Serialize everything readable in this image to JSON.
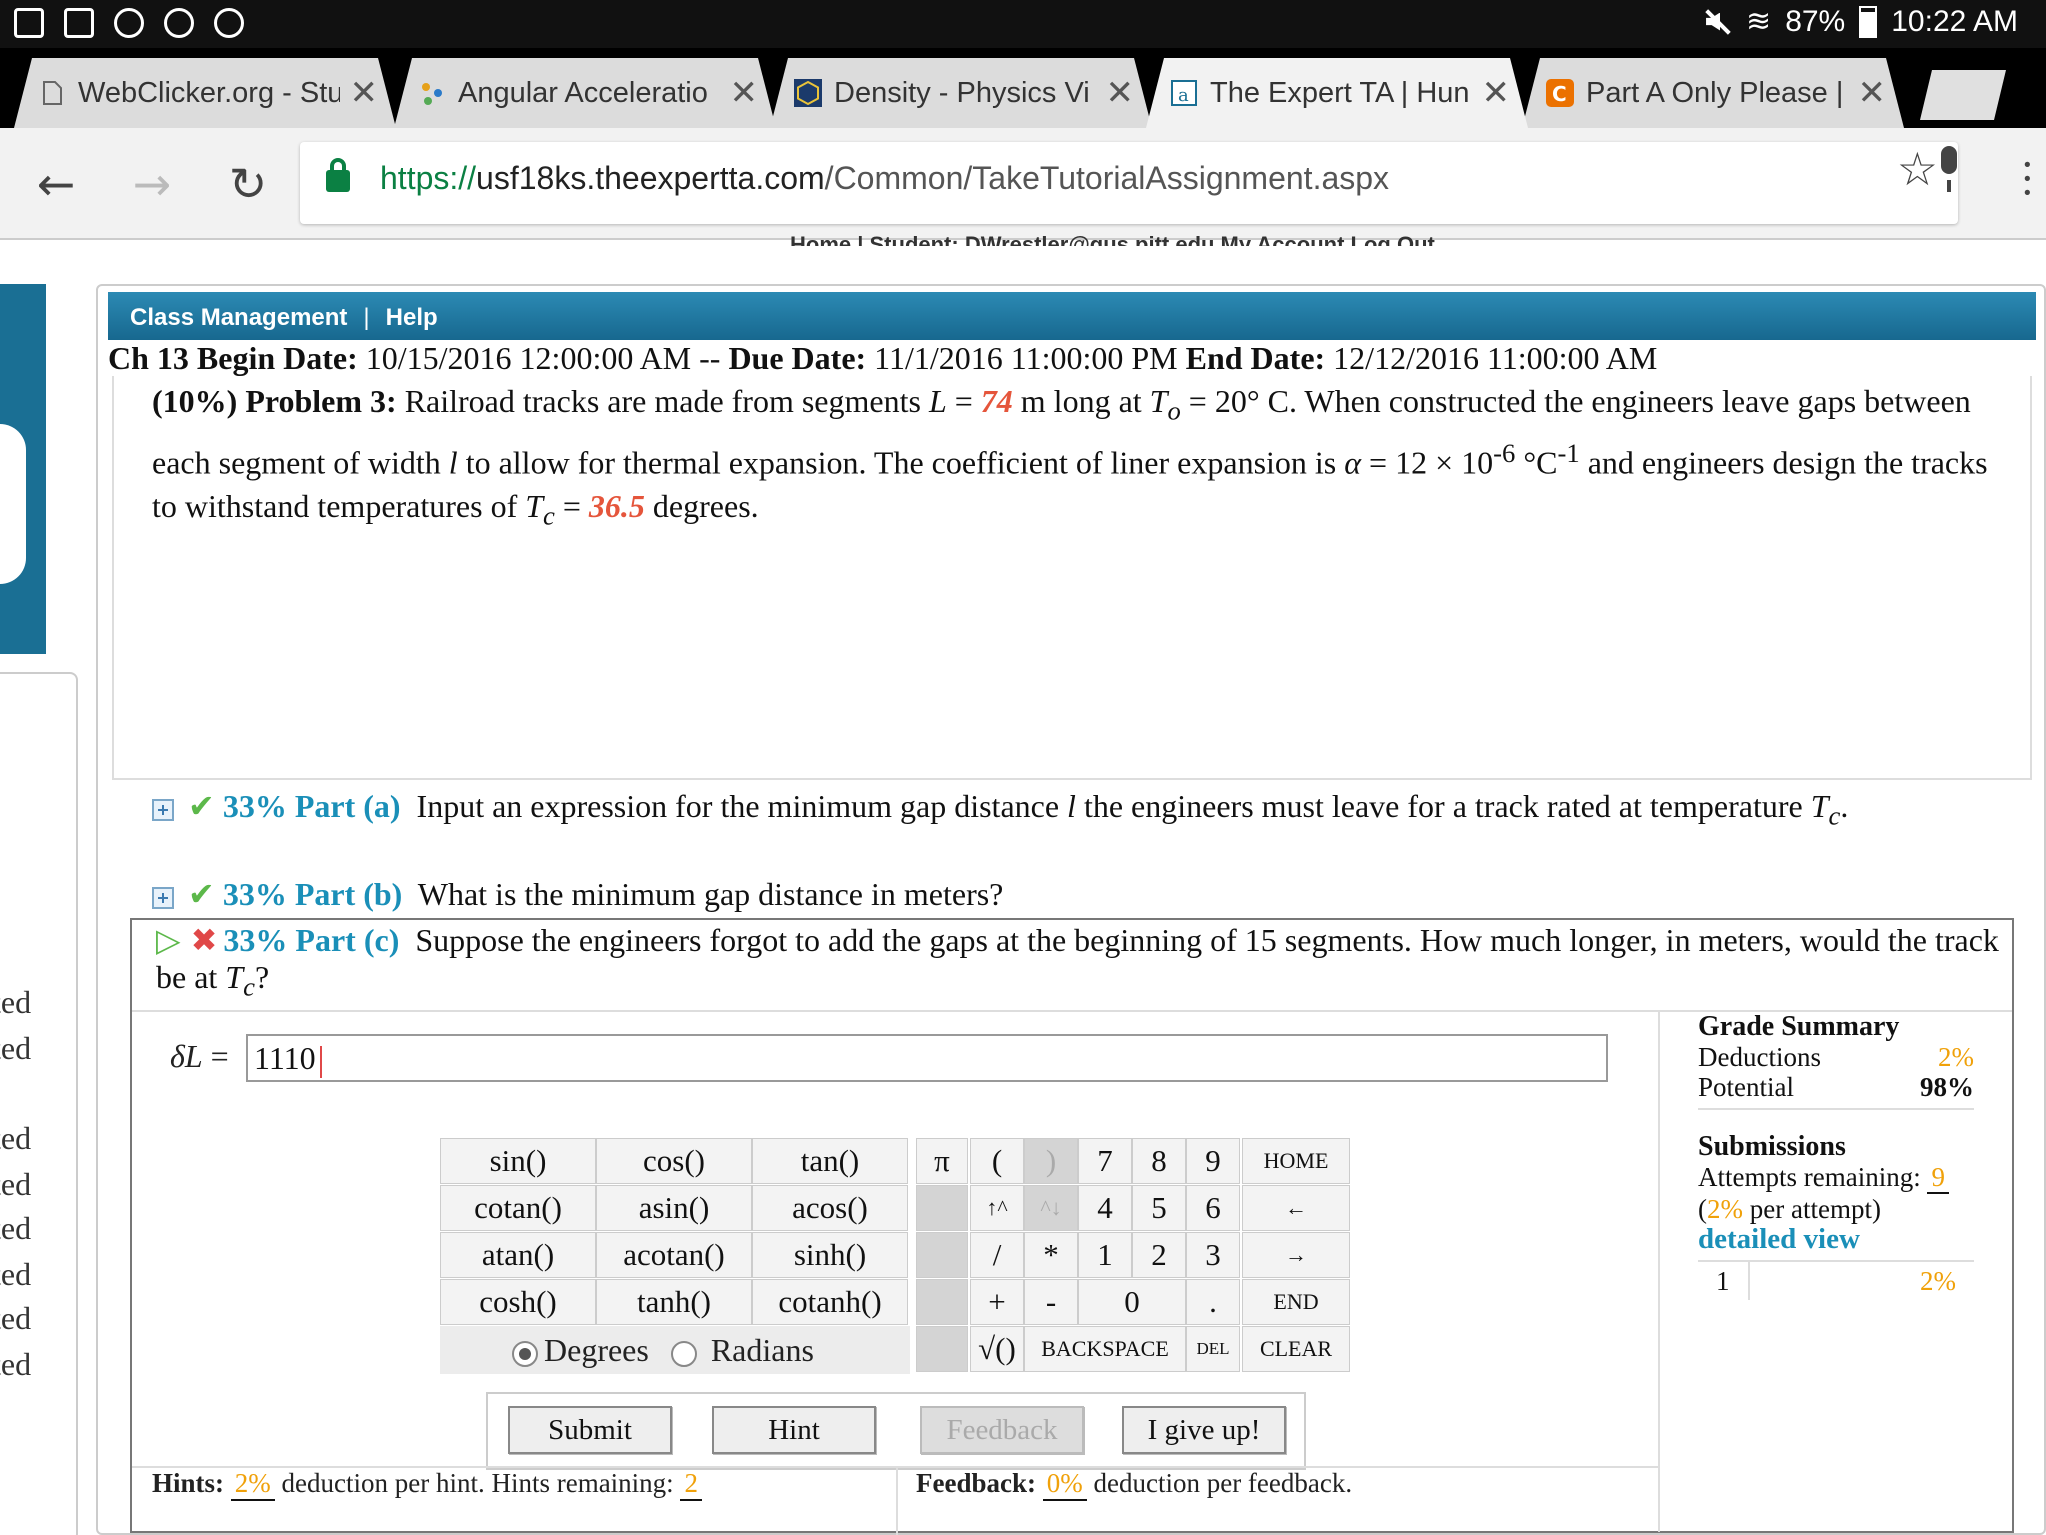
{
  "status_bar": {
    "battery": "87%",
    "time": "10:22 AM"
  },
  "tabs": [
    {
      "title": "WebClicker.org - Stu",
      "icon": "page-icon"
    },
    {
      "title": "Angular Acceleratio",
      "icon": "molecule-icon"
    },
    {
      "title": "Density - Physics Vi",
      "icon": "hexagon-icon"
    },
    {
      "title": "The Expert TA | Hun",
      "icon": "expertta-icon"
    },
    {
      "title": "Part A Only Please |",
      "icon": "chegg-c-icon"
    }
  ],
  "address_bar": {
    "scheme": "https://",
    "host": "usf18ks.theexpertta.com",
    "path": "/Common/TakeTutorialAssignment.aspx"
  },
  "top_menu_cut": "Home     |     Student: DWrestler@gus.pitt.edu     My Account     Log Out",
  "class_bar": {
    "class_management": "Class Management",
    "separator": "|",
    "help": "Help"
  },
  "dates": {
    "begin_label": "Ch 13 Begin Date:",
    "begin": "10/15/2016 12:00:00 AM",
    "due_sep": "--",
    "due_label": "Due Date:",
    "due": "11/1/2016 11:00:00 PM",
    "end_label": "End Date:",
    "end": "12/12/2016 11:00:00 AM"
  },
  "problem": {
    "label": "(10%) Problem 3:",
    "L_value": "74",
    "Tc_value": "36.5"
  },
  "parts": {
    "a": {
      "label": "33% Part (a)"
    },
    "b": {
      "label": "33% Part (b)",
      "text": "What is the minimum gap distance in meters?"
    },
    "c": {
      "label": "33% Part (c)"
    }
  },
  "answer": {
    "value": "1110"
  },
  "keypad": {
    "functions": [
      "sin()",
      "cos()",
      "tan()",
      "cotan()",
      "asin()",
      "acos()",
      "atan()",
      "acotan()",
      "sinh()",
      "cosh()",
      "tanh()",
      "cotanh()"
    ],
    "pi": "π",
    "open_paren": "(",
    "close_paren": ")",
    "up": "↑^",
    "down": "^↓",
    "slash": "/",
    "star": "*",
    "plus": "+",
    "minus": "-",
    "dot": ".",
    "digits": [
      "7",
      "8",
      "9",
      "4",
      "5",
      "6",
      "1",
      "2",
      "3",
      "0"
    ],
    "home": "HOME",
    "left": "←",
    "right": "→",
    "end": "END",
    "sqrt": "√()",
    "backspace": "BACKSPACE",
    "del": "DEL",
    "clear": "CLEAR",
    "degrees": "Degrees",
    "radians": "Radians"
  },
  "buttons": {
    "submit": "Submit",
    "hint": "Hint",
    "feedback": "Feedback",
    "give_up": "I give up!"
  },
  "hints": {
    "label": "Hints:",
    "pct": "2%",
    "text": "deduction per hint. Hints remaining:",
    "remaining": "2"
  },
  "feedback": {
    "label": "Feedback:",
    "pct": "0%",
    "text": "deduction per feedback."
  },
  "grade_summary": {
    "title": "Grade Summary",
    "deductions_label": "Deductions",
    "deductions": "2%",
    "potential_label": "Potential",
    "potential": "98%",
    "submissions_title": "Submissions",
    "attempts_label": "Attempts remaining:",
    "attempts": "9",
    "per_attempt_pct": "2%",
    "per_attempt_text": "per attempt)",
    "detailed_view": "detailed view",
    "row_num": "1",
    "row_pct": "2%"
  },
  "left_panel_items": [
    "ted",
    "ted",
    "ted",
    "ted",
    "ted",
    "ted",
    "ted",
    "ted"
  ],
  "colors": {
    "accent": "#1a8fb8",
    "highlight_red": "#e5553b",
    "orange": "#f0a10a",
    "header_blue": "#17688f"
  }
}
